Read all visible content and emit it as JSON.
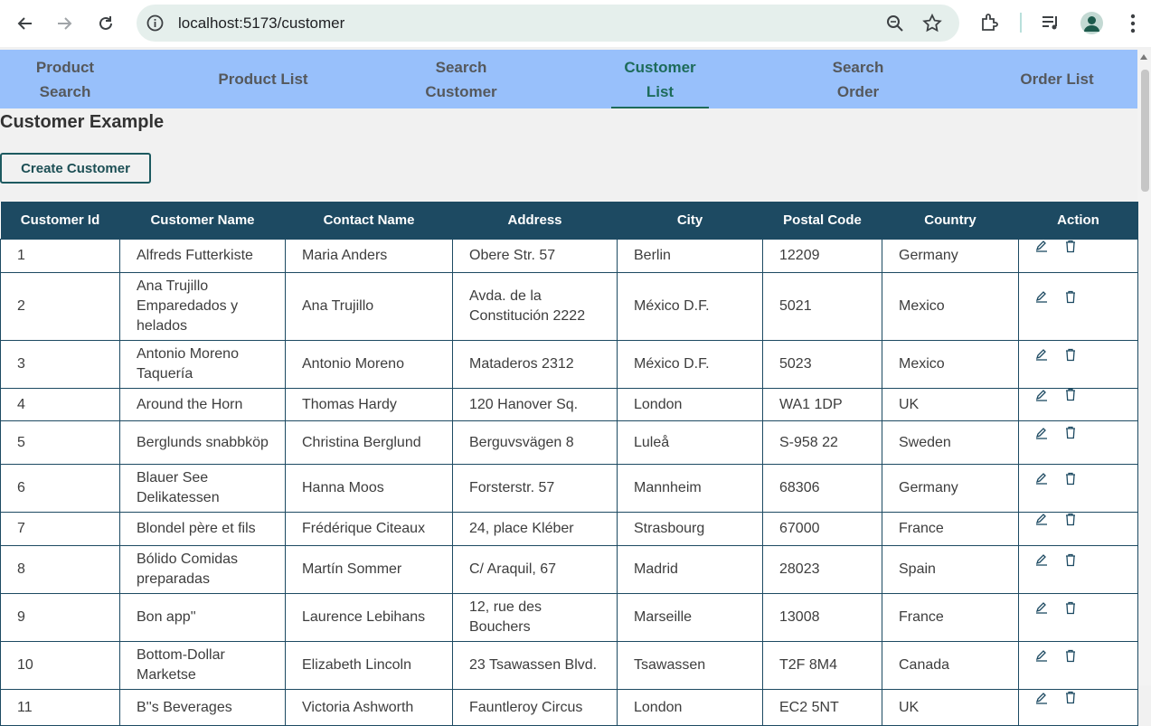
{
  "browser": {
    "url": "localhost:5173/customer"
  },
  "nav": {
    "tabs": [
      {
        "label": "Product Search"
      },
      {
        "label": "Product List"
      },
      {
        "label": "Search Customer"
      },
      {
        "label": "Customer List",
        "active": true
      },
      {
        "label": "Search Order"
      },
      {
        "label": "Order List"
      }
    ]
  },
  "page": {
    "title": "Customer Example",
    "create_button": "Create Customer"
  },
  "table": {
    "headers": [
      "Customer Id",
      "Customer Name",
      "Contact Name",
      "Address",
      "City",
      "Postal Code",
      "Country",
      "Action"
    ],
    "rows": [
      [
        "1",
        "Alfreds Futterkiste",
        "Maria Anders",
        "Obere Str. 57",
        "Berlin",
        "12209",
        "Germany"
      ],
      [
        "2",
        "Ana Trujillo Emparedados y helados",
        "Ana Trujillo",
        "Avda. de la Constitución 2222",
        "México D.F.",
        "5021",
        "Mexico"
      ],
      [
        "3",
        "Antonio Moreno Taquería",
        "Antonio Moreno",
        "Mataderos 2312",
        "México D.F.",
        "5023",
        "Mexico"
      ],
      [
        "4",
        "Around the Horn",
        "Thomas Hardy",
        "120 Hanover Sq.",
        "London",
        "WA1 1DP",
        "UK"
      ],
      [
        "5",
        "Berglunds snabbköp",
        "Christina Berglund",
        "Berguvsvägen 8",
        "Luleå",
        "S-958 22",
        "Sweden"
      ],
      [
        "6",
        "Blauer See Delikatessen",
        "Hanna Moos",
        "Forsterstr. 57",
        "Mannheim",
        "68306",
        "Germany"
      ],
      [
        "7",
        "Blondel père et fils",
        "Frédérique Citeaux",
        "24, place Kléber",
        "Strasbourg",
        "67000",
        "France"
      ],
      [
        "8",
        "Bólido Comidas preparadas",
        "Martín Sommer",
        "C/ Araquil, 67",
        "Madrid",
        "28023",
        "Spain"
      ],
      [
        "9",
        "Bon app''",
        "Laurence Lebihans",
        "12, rue des Bouchers",
        "Marseille",
        "13008",
        "France"
      ],
      [
        "10",
        "Bottom-Dollar Marketse",
        "Elizabeth Lincoln",
        "23 Tsawassen Blvd.",
        "Tsawassen",
        "T2F 8M4",
        "Canada"
      ],
      [
        "11",
        "B''s Beverages",
        "Victoria Ashworth",
        "Fauntleroy Circus",
        "London",
        "EC2 5NT",
        "UK"
      ]
    ]
  },
  "colors": {
    "nav_bg": "#98c0fb",
    "active_tab": "#1d6b5a",
    "table_header": "#1d4a62"
  }
}
